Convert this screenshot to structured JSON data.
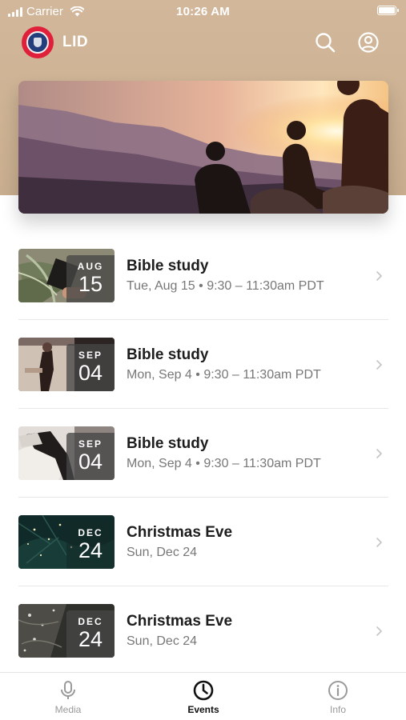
{
  "status_bar": {
    "carrier": "Carrier",
    "time": "10:26 AM"
  },
  "header": {
    "app_name": "LID",
    "logo_color": "#e0203a",
    "search_icon": "search-icon",
    "account_icon": "user-circle-icon"
  },
  "hero": {
    "image": "sunset-mountain-people"
  },
  "events": [
    {
      "title": "Bible study",
      "meta": "Tue, Aug 15 • 9:30 – 11:30am PDT",
      "month": "AUG",
      "day": "15",
      "thumb": "plant-bible"
    },
    {
      "title": "Bible study",
      "meta": "Mon, Sep 4 • 9:30 – 11:30am PDT",
      "month": "SEP",
      "day": "04",
      "thumb": "desk-coffee"
    },
    {
      "title": "Bible study",
      "meta": "Mon, Sep 4 • 9:30 – 11:30am PDT",
      "month": "SEP",
      "day": "04",
      "thumb": "person-reading"
    },
    {
      "title": "Christmas Eve",
      "meta": "Sun, Dec 24",
      "month": "DEC",
      "day": "24",
      "thumb": "christmas-tree"
    },
    {
      "title": "Christmas Eve",
      "meta": "Sun, Dec 24",
      "month": "DEC",
      "day": "24",
      "thumb": "christmas-lights"
    }
  ],
  "tabs": [
    {
      "label": "Media",
      "icon": "microphone-icon",
      "active": false
    },
    {
      "label": "Events",
      "icon": "clock-icon",
      "active": true
    },
    {
      "label": "Info",
      "icon": "info-icon",
      "active": false
    }
  ]
}
